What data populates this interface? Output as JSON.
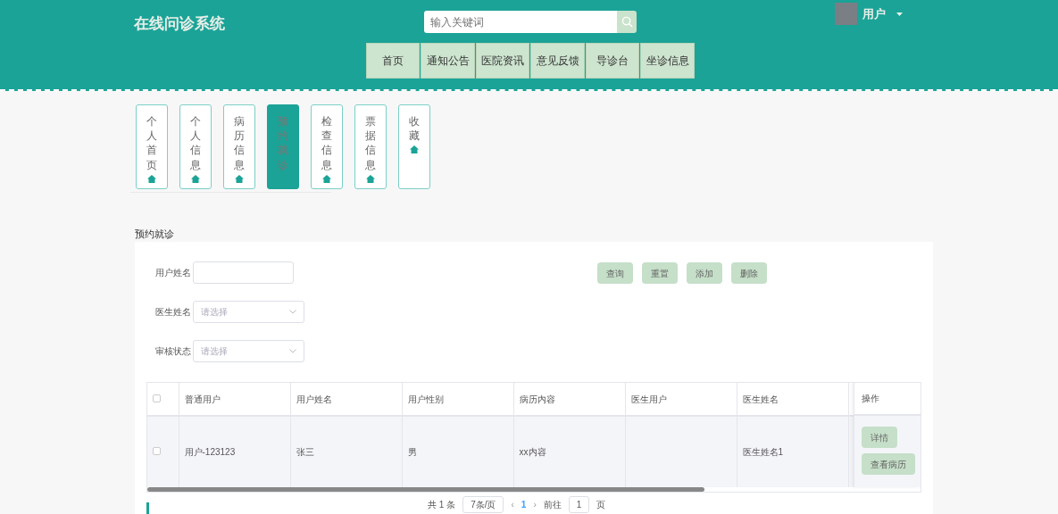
{
  "header": {
    "logo": "在线问诊系统",
    "search": {
      "placeholder": "输入关键词"
    },
    "user": "用户"
  },
  "nav": [
    {
      "label": "首页"
    },
    {
      "label": "通知公告"
    },
    {
      "label": "医院资讯"
    },
    {
      "label": "意见反馈"
    },
    {
      "label": "导诊台"
    },
    {
      "label": "坐诊信息"
    }
  ],
  "side_tabs": [
    {
      "label": "个人首页",
      "selected": false
    },
    {
      "label": "个人信息",
      "selected": false
    },
    {
      "label": "病历信息",
      "selected": false
    },
    {
      "label": "预约就诊",
      "selected": true
    },
    {
      "label": "检查信息",
      "selected": false
    },
    {
      "label": "票据信息",
      "selected": false
    },
    {
      "label": "收藏",
      "selected": false
    }
  ],
  "page_title": "预约就诊",
  "filters": [
    {
      "kind": "input",
      "label": "用户姓名"
    },
    {
      "kind": "select",
      "label": "医生姓名",
      "placeholder": "请选择"
    },
    {
      "kind": "select",
      "label": "审核状态",
      "placeholder": "请选择"
    }
  ],
  "buttons": [
    "查询",
    "重置",
    "添加",
    "删除"
  ],
  "table": {
    "columns": [
      "普通用户",
      "用户姓名",
      "用户性别",
      "病历内容",
      "医生用户",
      "医生姓名"
    ],
    "action_column": "操作",
    "header_checked": false,
    "rows": [
      {
        "checked": false,
        "cells": [
          "用户-123123",
          "张三",
          "男",
          "xx内容",
          "",
          "医生姓名1"
        ],
        "actions": [
          "详情",
          "查看病历"
        ]
      }
    ]
  },
  "pagination": {
    "total": "共 1 条",
    "page_size": "7条/页",
    "prev": "‹",
    "pages": [
      {
        "label": "1",
        "selected": true
      }
    ],
    "next": "›",
    "goto_label": "前往",
    "goto_value": "1",
    "goto_suffix": "页"
  }
}
